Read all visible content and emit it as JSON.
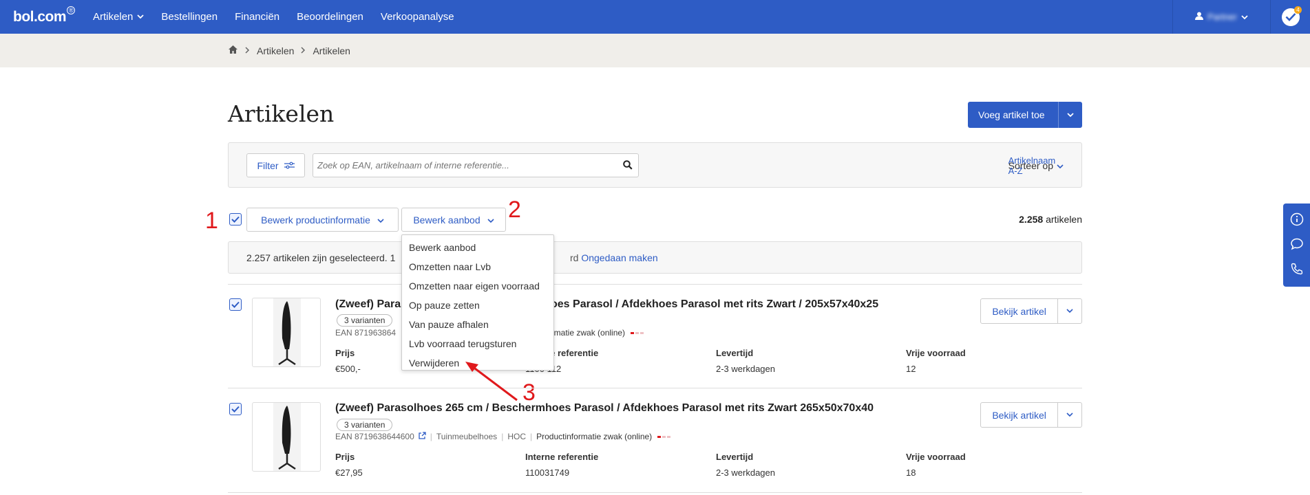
{
  "brand": {
    "logo": "bol.com",
    "reg_mark": "®"
  },
  "nav": {
    "items": [
      {
        "label": "Artikelen",
        "dropdown": true
      },
      {
        "label": "Bestellingen"
      },
      {
        "label": "Financiën"
      },
      {
        "label": "Beoordelingen"
      },
      {
        "label": "Verkoopanalyse"
      }
    ],
    "notification_count": "4",
    "user_name": "Partner"
  },
  "breadcrumb": [
    "Artikelen",
    "Artikelen"
  ],
  "page": {
    "title": "Artikelen",
    "add_button": "Voeg artikel toe"
  },
  "filter": {
    "filter_label": "Filter",
    "search_placeholder": "Zoek op EAN, artikelnaam of interne referentie...",
    "sort_label": "Sorteer op",
    "sort_value": "Artikelnaam A-Z"
  },
  "actions": {
    "edit_product_info": "Bewerk productinformatie",
    "edit_offer": "Bewerk aanbod",
    "count_value": "2.258",
    "count_label": "artikelen"
  },
  "selection_notice": {
    "text": "2.257 artikelen zijn geselecteerd. 1",
    "tail": "rd",
    "undo": "Ongedaan maken"
  },
  "dropdown_options": [
    "Bewerk aanbod",
    "Omzetten naar Lvb",
    "Omzetten naar eigen voorraad",
    "Op pauze zetten",
    "Van pauze afhalen",
    "Lvb voorraad terugsturen",
    "Verwijderen"
  ],
  "annotations": {
    "one": "1",
    "two": "2",
    "three": "3",
    "color": "#e0191c"
  },
  "columns": {
    "price": "Prijs",
    "reference": "Interne referentie",
    "delivery": "Levertijd",
    "stock": "Vrije voorraad"
  },
  "products": [
    {
      "title_left": "(Zweef) Para",
      "title_right": "oes Parasol / Afdekhoes Parasol met rits Zwart / 205x57x40x25",
      "variants": "3 varianten",
      "ean": "EAN 871963864",
      "quality": "ctinformatie zwak (online)",
      "price": "€500,-",
      "reference": "1100 112",
      "delivery": "2-3 werkdagen",
      "stock": "12",
      "view": "Bekijk artikel"
    },
    {
      "title": "(Zweef) Parasolhoes 265 cm / Beschermhoes Parasol / Afdekhoes Parasol met rits Zwart 265x50x70x40",
      "variants": "3 varianten",
      "ean": "EAN 8719638644600",
      "category": "Tuinmeubelhoes",
      "brand": "HOC",
      "quality": "Productinformatie zwak (online)",
      "price": "€27,95",
      "reference": "110031749",
      "delivery": "2-3 werkdagen",
      "stock": "18",
      "view": "Bekijk artikel"
    }
  ],
  "colors": {
    "brand_blue": "#2e5cc5",
    "strip": "#f0eeea"
  }
}
